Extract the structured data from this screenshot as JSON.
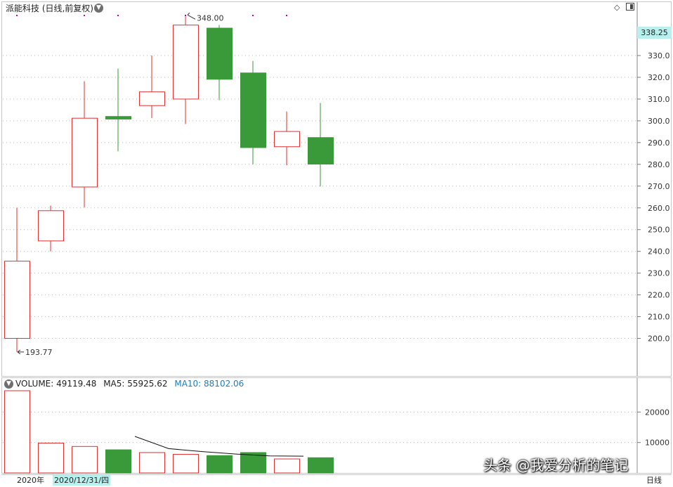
{
  "header": {
    "title": "派能科技 (日线,前复权)",
    "dropdown_icon": "chevron-down-icon",
    "diamond_icon": "diamond-icon",
    "window_icon": "window-toggle-icon"
  },
  "price_tag": "338.25",
  "volume_header": {
    "volume_label": "VOLUME: 49119.48",
    "ma5_label": "MA5: 55925.62",
    "ma10_label": "MA10: 88102.06"
  },
  "bottom": {
    "year_label": "2020年",
    "date_label": "2020/12/31/四",
    "period_label": "日线"
  },
  "watermark": "头条 @我爱分析的笔记",
  "colors": {
    "up": "#e03030",
    "down": "#3a9a3a",
    "ma10": "#1a7fc1",
    "price_tag_bg": "#b8f0ee",
    "marker": "#c000c0"
  },
  "chart_data": [
    {
      "type": "candlestick",
      "title": "派能科技 (日线,前复权)",
      "ylim": [
        185,
        351
      ],
      "yticks": [
        200,
        210,
        220,
        230,
        240,
        250,
        260,
        270,
        280,
        290,
        300,
        310,
        320,
        330
      ],
      "grid": true,
      "annotations": [
        {
          "label": "348.00",
          "type": "high"
        },
        {
          "label": "193.77",
          "type": "low"
        }
      ],
      "candles": [
        {
          "open": 200.0,
          "high": 260.0,
          "low": 193.77,
          "close": 235.5
        },
        {
          "open": 244.8,
          "high": 261.0,
          "low": 240.0,
          "close": 258.7
        },
        {
          "open": 269.6,
          "high": 318.2,
          "low": 260.2,
          "close": 301.2
        },
        {
          "open": 302.0,
          "high": 324.0,
          "low": 286.0,
          "close": 300.8
        },
        {
          "open": 307.0,
          "high": 330.0,
          "low": 301.3,
          "close": 313.3
        },
        {
          "open": 310.0,
          "high": 348.0,
          "low": 298.5,
          "close": 344.0
        },
        {
          "open": 342.6,
          "high": 344.0,
          "low": 309.5,
          "close": 319.1
        },
        {
          "open": 322.0,
          "high": 327.5,
          "low": 280.0,
          "close": 287.7
        },
        {
          "open": 288.1,
          "high": 304.3,
          "low": 279.6,
          "close": 295.1
        },
        {
          "open": 292.3,
          "high": 308.2,
          "low": 269.8,
          "close": 280.1
        }
      ]
    },
    {
      "type": "bar",
      "title": "VOLUME",
      "ylim": [
        0,
        27000
      ],
      "yticks": [
        10000,
        20000
      ],
      "values": [
        27000,
        9800,
        8700,
        7600,
        6700,
        6100,
        5700,
        6700,
        4600,
        5000
      ],
      "directions": [
        "up",
        "up",
        "up",
        "down",
        "up",
        "up",
        "down",
        "down",
        "up",
        "down"
      ],
      "ma_series": [
        {
          "name": "MA10",
          "points": [
            [
              4,
              12000
            ],
            [
              5,
              8000
            ],
            [
              6,
              7000
            ],
            [
              7,
              6200
            ],
            [
              8,
              5600
            ],
            [
              9,
              5500
            ]
          ]
        }
      ]
    }
  ]
}
